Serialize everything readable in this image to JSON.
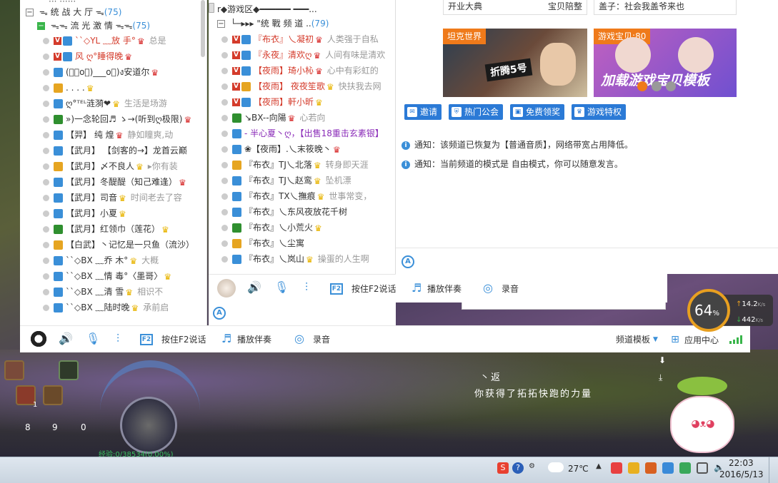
{
  "left_list": {
    "top_partial": "··· ······",
    "header1": {
      "toggle": "−",
      "name": "ᯓ  统 战 大 厅  ᯓ",
      "count": "(75)"
    },
    "header2": {
      "toggle": "−",
      "name": "ᯓᯓ 流 光 激 情 ᯓᯓ",
      "count": "(75)"
    },
    "rows": [
      {
        "v": true,
        "name": "``◇YL    ﹏放 手°",
        "crown": "red",
        "note": "总是"
      },
      {
        "v": true,
        "name": "风 ღ°睡得晚",
        "crown": "red",
        "note": ""
      },
      {
        "v": false,
        "name": "(ง゚o゚)___o゚)ง安道尔",
        "crown": "red",
        "note": ""
      },
      {
        "v": false,
        "name": ". . . .",
        "crown": "gold",
        "note": ""
      },
      {
        "v": false,
        "name": "ღ°ᵀᴱᴸ涟漪❤",
        "crown": "gold",
        "note": "生活是场游"
      },
      {
        "v": false,
        "name": "»)一念轮回♬ ゝ→(听到ღ极限)",
        "crown": "red",
        "note": ""
      },
      {
        "v": false,
        "name": "【羿】 纯 煌",
        "crown": "red",
        "note": "静如瞳爽,动"
      },
      {
        "v": false,
        "name": "【武月】 【剑客的→】龙首云巅",
        "crown": "",
        "note": ""
      },
      {
        "v": false,
        "name": "【武月】〆不良人",
        "crown": "gold",
        "note": "▸你有装"
      },
      {
        "v": false,
        "name": "【武月】冬醍醍（知己难逢）",
        "crown": "red",
        "note": ""
      },
      {
        "v": false,
        "name": "【武月】司音",
        "crown": "gold",
        "note": "时间老去了容"
      },
      {
        "v": false,
        "name": "【武月】小夏",
        "crown": "gold",
        "note": ""
      },
      {
        "v": false,
        "name": "【武月】红领巾（莲花）",
        "crown": "gold",
        "note": ""
      },
      {
        "v": false,
        "name": "【白武】丶记忆是一只鱼（流沙）",
        "crown": "",
        "note": ""
      },
      {
        "v": false,
        "name": "``◇BX    ﹏乔 木°",
        "crown": "gold",
        "note": "大概"
      },
      {
        "v": false,
        "name": "``◇BX    ﹏情 毒°〈墨哥〉",
        "crown": "gold",
        "note": ""
      },
      {
        "v": false,
        "name": "``◇BX    ﹏清 雪",
        "crown": "gold",
        "note": "相识不"
      },
      {
        "v": false,
        "name": "``◇BX    ﹏陆时晚",
        "crown": "gold",
        "note": "承前启"
      }
    ]
  },
  "mid_list": {
    "header1": {
      "name": "r◆游戏区◆━━━━━━ ━━━..."
    },
    "header2": {
      "name": "└─▸▸▸ \"统  戰  频  道 ..",
      "count": "(79)"
    },
    "rows": [
      {
        "v": true,
        "name": "『布衣』乀凝初",
        "crown": "red",
        "note": "人类强于自私"
      },
      {
        "v": true,
        "name": "『永夜』清欢ღ",
        "crown": "red",
        "note": "人间有味是清欢"
      },
      {
        "v": true,
        "name": "【夜雨】琦小杺",
        "crown": "red",
        "note": "心中有彩虹的"
      },
      {
        "v": true,
        "name": "【夜雨】 夜夜笙歌",
        "crown": "gold",
        "note": "快扶我去网"
      },
      {
        "v": true,
        "name": "【夜雨】軒小昕",
        "crown": "gold",
        "note": ""
      },
      {
        "v": false,
        "name": "↘BX--向陽",
        "crown": "red",
        "note": "心若向"
      },
      {
        "v": false,
        "name": "- 半心夏丶ღ，【出售18重击玄素银】",
        "crown": "",
        "note": ""
      },
      {
        "v": false,
        "name": "❀【夜雨】.乀末筱晚丶",
        "crown": "red",
        "note": ""
      },
      {
        "v": false,
        "name": "『布衣』TJ乀北落",
        "crown": "gold",
        "note": "转身即天涯"
      },
      {
        "v": false,
        "name": "『布衣』TJ乀赵鸾",
        "crown": "gold",
        "note": "坠机漂"
      },
      {
        "v": false,
        "name": "『布衣』TX乀撫痕",
        "crown": "gold",
        "note": "世事常变，"
      },
      {
        "v": false,
        "name": "『布衣』乀东风夜放花千树",
        "crown": "",
        "note": ""
      },
      {
        "v": false,
        "name": "『布衣』乀小荒火",
        "crown": "gold",
        "note": ""
      },
      {
        "v": false,
        "name": "『布衣』乀尘寓",
        "crown": "",
        "note": ""
      },
      {
        "v": false,
        "name": "『布衣』乀岚山",
        "crown": "gold",
        "note": "操蛋的人生啊"
      }
    ]
  },
  "ads": {
    "top_left": {
      "left": "开业大典",
      "right": "宝贝陪整"
    },
    "top_right": "盖子：社会我盖爷来也",
    "card1_label": "坦克世界",
    "card1_text": "折腾5号",
    "card2_label": "游戏宝贝",
    "card2_count": "80",
    "card2_text": "加载游戏宝贝模板"
  },
  "action_buttons": [
    "邀请",
    "热门公会",
    "免费领奖",
    "游戏特权"
  ],
  "notices": [
    "通知：该频道已恢复为【普通音质】，网络带宽占用降低。",
    "通知：当前频道的模式是 自由模式，你可以随意发言。"
  ],
  "toolbar": {
    "f2_label": "F2",
    "talk_label": "按住F2说话",
    "music_label": "播放伴奏",
    "record_label": "录音",
    "template_label": "频道模板",
    "app_center_label": "应用中心"
  },
  "speed": {
    "percent": "64",
    "unit": "%",
    "up": "14.2",
    "up_unit": "K/s",
    "down": "442",
    "down_unit": "K/s"
  },
  "game": {
    "message_line1": "丶返",
    "message_line2": "你获得了拓拓快跑的力量",
    "skill_nums": [
      "1",
      "8",
      "9",
      "0"
    ],
    "exp_label": "经验",
    "exp_value": "0/38534(0.00%)"
  },
  "taskbar": {
    "weather": "27℃",
    "time": "22:03",
    "date": "2016/5/13"
  }
}
